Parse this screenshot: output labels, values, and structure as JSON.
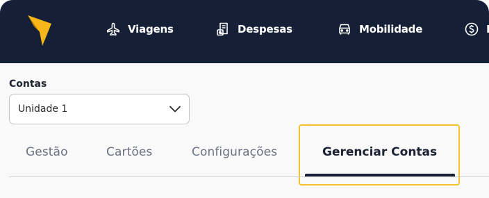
{
  "nav": {
    "items": [
      {
        "label": "Viagens",
        "icon": "airplane-icon"
      },
      {
        "label": "Despesas",
        "icon": "receipt-icon"
      },
      {
        "label": "Mobilidade",
        "icon": "car-icon"
      },
      {
        "label": "F",
        "icon": "dollar-icon"
      }
    ]
  },
  "accounts": {
    "label": "Contas",
    "selected": "Unidade 1"
  },
  "tabs": {
    "items": [
      "Gestão",
      "Cartões",
      "Configurações"
    ],
    "active": "Gerenciar Contas"
  },
  "colors": {
    "topbar": "#152036",
    "logo": "#f7b718",
    "highlight": "#f4c430"
  }
}
